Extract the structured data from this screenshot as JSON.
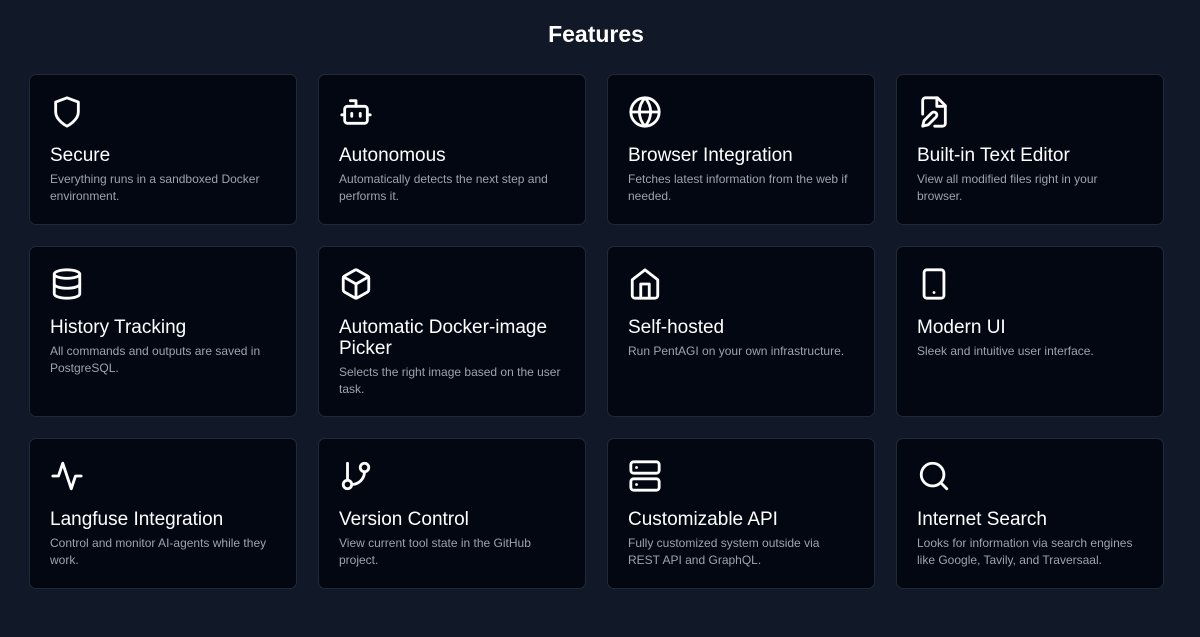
{
  "page": {
    "title": "Features"
  },
  "features": [
    {
      "title": "Secure",
      "description": "Everything runs in a sandboxed Docker environment.",
      "icon": "shield-icon"
    },
    {
      "title": "Autonomous",
      "description": "Automatically detects the next step and performs it.",
      "icon": "bot-icon"
    },
    {
      "title": "Browser Integration",
      "description": "Fetches latest information from the web if needed.",
      "icon": "globe-icon"
    },
    {
      "title": "Built-in Text Editor",
      "description": "View all modified files right in your browser.",
      "icon": "file-edit-icon"
    },
    {
      "title": "History Tracking",
      "description": "All commands and outputs are saved in PostgreSQL.",
      "icon": "database-icon"
    },
    {
      "title": "Automatic Docker-image Picker",
      "description": "Selects the right image based on the user task.",
      "icon": "box-icon"
    },
    {
      "title": "Self-hosted",
      "description": "Run PentAGI on your own infrastructure.",
      "icon": "home-icon"
    },
    {
      "title": "Modern UI",
      "description": "Sleek and intuitive user interface.",
      "icon": "tablet-icon"
    },
    {
      "title": "Langfuse Integration",
      "description": "Control and monitor AI-agents while they work.",
      "icon": "activity-icon"
    },
    {
      "title": "Version Control",
      "description": "View current tool state in the GitHub project.",
      "icon": "git-branch-icon"
    },
    {
      "title": "Customizable API",
      "description": "Fully customized system outside via REST API and GraphQL.",
      "icon": "server-icon"
    },
    {
      "title": "Internet Search",
      "description": "Looks for information via search engines like Google, Tavily, and Traversaal.",
      "icon": "search-icon"
    }
  ]
}
